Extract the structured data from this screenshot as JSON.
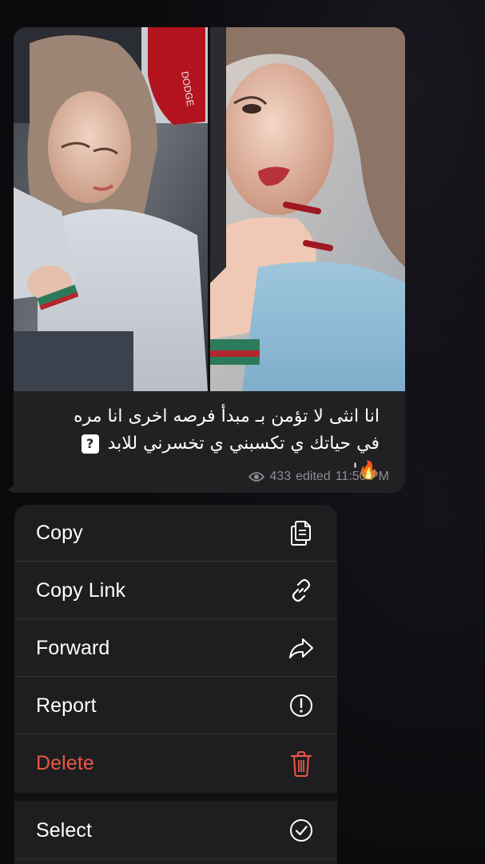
{
  "message": {
    "caption_line1": "انا انثى لا تؤمن بـ مبدأ فرصه اخرى انا مره",
    "caption_line2": "في حياتك ي تكسبني ي تخسرني للابد",
    "caption_line3": "🔥'",
    "unknown_glyph": "?",
    "views": "433",
    "edited_label": "edited",
    "time": "11:50 PM"
  },
  "menu": {
    "items": [
      {
        "label": "Copy",
        "icon": "copy-icon"
      },
      {
        "label": "Copy Link",
        "icon": "link-icon"
      },
      {
        "label": "Forward",
        "icon": "forward-icon"
      },
      {
        "label": "Report",
        "icon": "report-icon"
      },
      {
        "label": "Delete",
        "icon": "trash-icon"
      },
      {
        "label": "Select",
        "icon": "check-circle-icon"
      }
    ]
  },
  "colors": {
    "background": "#0b0a0c",
    "bubble": "#212124",
    "menu": "#1e1e20",
    "danger": "#eb5545",
    "meta_text": "#8e8e93"
  }
}
